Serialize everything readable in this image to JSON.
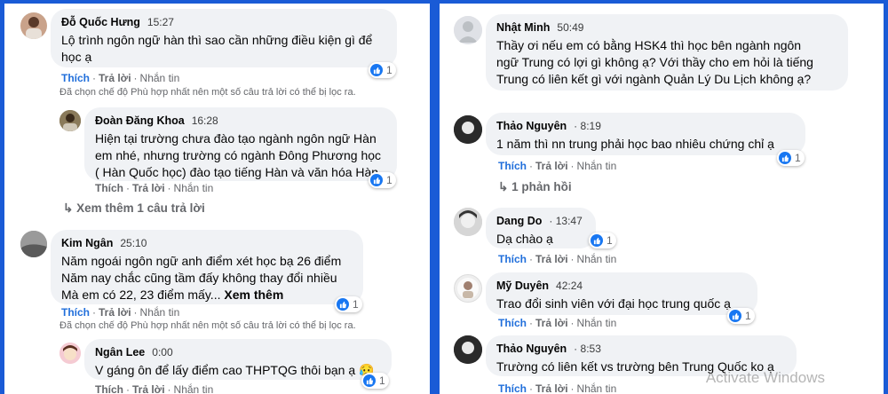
{
  "common": {
    "like": "Thích",
    "reply": "Trả lời",
    "message": "Nhắn tin",
    "filter_note": "Đã chọn chế độ Phù hợp nhất nên một số câu trả lời có thể bị lọc ra.",
    "like_color": "#216fdb",
    "bubble_color": "#f0f2f5"
  },
  "left": {
    "c1": {
      "name": "Đỗ Quốc Hưng",
      "time": "15:27",
      "line1": "Lộ trình ngôn ngữ hàn thì sao cần những điều kiện gì để",
      "line2": "học ạ",
      "reactions": "1"
    },
    "c2": {
      "name": "Đoàn Đăng Khoa",
      "time": "16:28",
      "line1": "Hiện tại trường chưa đào tạo ngành ngôn ngữ Hàn",
      "line2": "em nhé, nhưng trường có ngành Đông Phương học",
      "line3": "( Hàn Quốc học) đào tạo tiếng Hàn và văn hóa Hàn.",
      "reactions": "1"
    },
    "see_more_replies": "Xem thêm 1 câu trả lời",
    "c3": {
      "name": "Kim Ngân",
      "time": "25:10",
      "line1": "Năm ngoái ngôn ngữ anh điểm xét học bạ 26 điểm",
      "line2": "Năm nay chắc cũng tầm đấy không thay đổi nhiều",
      "line3": "Mà em có 22, 23 điểm mấy...",
      "see_more": "Xem thêm",
      "reactions": "1"
    },
    "c4": {
      "name": "Ngân Lee",
      "time": "0:00",
      "line1": "V gáng ôn để lấy điểm cao THPTQG thôi bạn ạ 😥",
      "reactions": "1"
    }
  },
  "right": {
    "c1": {
      "name": "Nhật Minh",
      "time": "50:49",
      "line1": "Thầy ơi nếu em có bằng HSK4 thì học bên ngành ngôn",
      "line2": "ngữ Trung có lợi gì không ạ? Với thầy cho em hỏi là tiếng",
      "line3": "Trung có liên kết gì với ngành Quản Lý Du Lịch không ạ?"
    },
    "c2": {
      "name": "Thảo Nguyên",
      "time": "8:19",
      "line1": "1 năm thì nn trung phải học bao nhiêu chứng chỉ ạ",
      "reactions": "1",
      "replies": "1 phản hồi"
    },
    "c3": {
      "name": "Dang Do",
      "time": "13:47",
      "line1": "Dạ chào ạ",
      "reactions": "1"
    },
    "c4": {
      "name": "Mỹ Duyên",
      "time": "42:24",
      "line1": "Trao đổi sinh viên với đại học trung quốc ạ",
      "reactions": "1"
    },
    "c5": {
      "name": "Thảo Nguyên",
      "time": "8:53",
      "line1": "Trường có liên kết vs trường bên Trung Quốc ko ạ"
    }
  },
  "watermark": "Activate Windows"
}
